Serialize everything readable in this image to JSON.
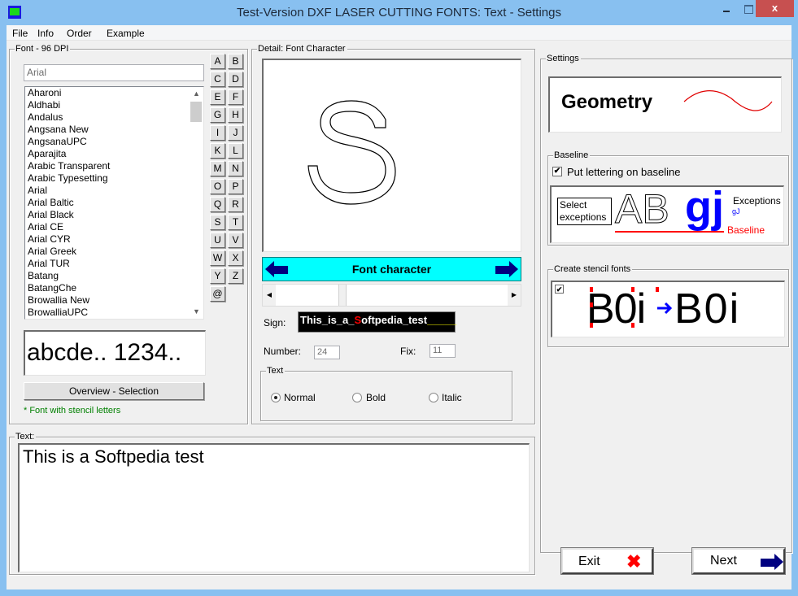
{
  "window": {
    "title": "Test-Version  DXF LASER CUTTING FONTS: Text - Settings",
    "app_icon": "app-logo-icon",
    "controls": {
      "minimize": "minimize-icon",
      "maximize": "maximize-icon",
      "close_glyph": "x"
    }
  },
  "menu": [
    {
      "label": "File"
    },
    {
      "label": "Info"
    },
    {
      "label": "Order"
    },
    {
      "label": "Example"
    }
  ],
  "font_panel": {
    "group_label": "Font -  96 DPI",
    "font_input_value": "Arial",
    "letters": [
      "A",
      "B",
      "C",
      "D",
      "E",
      "F",
      "G",
      "H",
      "I",
      "J",
      "K",
      "L",
      "M",
      "N",
      "O",
      "P",
      "Q",
      "R",
      "S",
      "T",
      "U",
      "V",
      "W",
      "X",
      "Y",
      "Z",
      "@"
    ],
    "fonts": [
      "Aharoni",
      "Aldhabi",
      "Andalus",
      "Angsana New",
      "AngsanaUPC",
      "Aparajita",
      "Arabic Transparent",
      "Arabic Typesetting",
      "Arial",
      "Arial Baltic",
      "Arial Black",
      "Arial CE",
      "Arial CYR",
      "Arial Greek",
      "Arial TUR",
      "Batang",
      "BatangChe",
      "Browallia New",
      "BrowalliaUPC"
    ],
    "preview_text": "abcde.. 1234..",
    "overview_button": "Overview - Selection",
    "stencil_note": "* Font with stencil letters",
    "stencil_note_color": "#008000"
  },
  "detail_panel": {
    "group_label": "Detail: Font Character",
    "character": "S",
    "nav_label": "Font character",
    "nav_bg_color": "#00ffff",
    "nav_arrow_color": "#000080",
    "sign_label": "Sign:",
    "sign_prefix": "This_is_a_",
    "sign_current": "S",
    "sign_suffix": "oftpedia_test",
    "sign_trailing": "_____",
    "sign_current_color": "#ff0000",
    "sign_trailing_color": "#ffff00",
    "number_label": "Number:",
    "number_value": "24",
    "fix_label": "Fix:",
    "fix_value": "11",
    "slider_position": 0.28,
    "text_group_label": "Text",
    "styles": [
      {
        "label": "Normal",
        "checked": true
      },
      {
        "label": "Bold",
        "checked": false
      },
      {
        "label": "Italic",
        "checked": false
      }
    ]
  },
  "text_panel": {
    "group_label": "Text:",
    "value": "This is a Softpedia test"
  },
  "settings_panel": {
    "group_label": "Settings",
    "geometry_label": "Geometry",
    "wave_color": "#e00000",
    "baseline": {
      "group_label": "Baseline",
      "checkbox_label": "Put lettering on baseline",
      "checked": true,
      "select_exceptions": "Select exceptions",
      "sample_outline": "AB",
      "sample_filled": "gj",
      "exceptions_label": "Exceptions",
      "exceptions_value": "gJ",
      "baseline_label": "Baseline",
      "baseline_color": "#ff0000",
      "filled_color": "#0000ff"
    },
    "stencil": {
      "group_label": "Create stencil fonts",
      "checked": true,
      "sample_before": "B0i",
      "sample_after": "B0i",
      "arrow_color": "#0000ff",
      "bridge_color": "#ff0000"
    }
  },
  "footer": {
    "exit_label": "Exit",
    "exit_icon_color": "#ff0000",
    "next_label": "Next",
    "next_icon_color": "#000080"
  }
}
